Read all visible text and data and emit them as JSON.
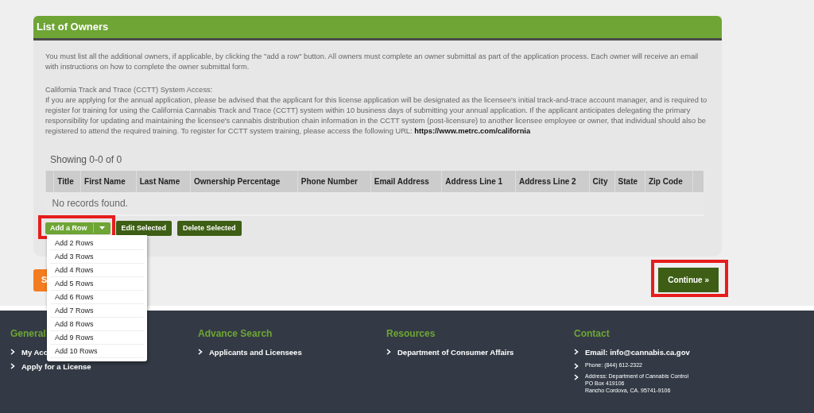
{
  "panel": {
    "title": "List of Owners",
    "intro": "You must list all the additional owners, if applicable, by clicking the \"add a row\" button. All owners must complete an owner submittal as part of the application process. Each owner will receive an email with instructions on how to complete the owner submittal form.",
    "cctt_heading": "California Track and Trace (CCTT) System Access:",
    "cctt_text": "If you are applying for the annual application, please be advised that the applicant for this license application will be designated as the licensee's initial track-and-trace account manager, and is required to register for training for using the California Cannabis Track and Trace (CCTT) system within 10 business days of submitting your annual application. If the applicant anticipates delegating the primary responsibility for updating and maintaining the licensee's cannabis distribution chain information in the CCTT system (post-licensure) to another licensee employee or owner, that individual should also be registered to attend the required training. To register for CCTT system training, please access the following URL:",
    "url": "https://www.metrc.com/california"
  },
  "showing": "Showing 0-0 of 0",
  "table": {
    "columns": [
      "Title",
      "First Name",
      "Last Name",
      "Ownership Percentage",
      "Phone Number",
      "Email Address",
      "Address Line 1",
      "Address Line 2",
      "City",
      "State",
      "Zip Code"
    ],
    "empty_message": "No records found."
  },
  "actions": {
    "add_button": "Add a Row",
    "highlighted": true,
    "menu_expanded": true,
    "menu": [
      "Add 2 Rows",
      "Add 3 Rows",
      "Add 4 Rows",
      "Add 5 Rows",
      "Add 6 Rows",
      "Add 7 Rows",
      "Add 8 Rows",
      "Add 9 Rows",
      "Add 10 Rows"
    ],
    "buttons": [
      "Edit Selected",
      "Delete Selected"
    ]
  },
  "back_button": "S",
  "continue": {
    "label": "Continue »",
    "highlighted": true
  },
  "footer": [
    {
      "heading": "General",
      "links": [
        {
          "text": "My Acc",
          "kind": "link"
        },
        {
          "text": "Apply for a License",
          "kind": "link"
        }
      ]
    },
    {
      "heading": "Advance Search",
      "links": [
        {
          "text": "Applicants and Licensees",
          "kind": "link"
        }
      ]
    },
    {
      "heading": "Resources",
      "links": [
        {
          "text": "Department of Consumer Affairs",
          "kind": "link"
        }
      ]
    },
    {
      "heading": "Contact",
      "links": [
        {
          "text": "Email: info@cannabis.ca.gov",
          "kind": "link"
        },
        {
          "text": "Phone: (844) 612-2322",
          "kind": "detail"
        },
        {
          "text": "Address: Department of Cannabis Control\nPO Box 419106\nRancho Cordova, CA. 95741-9106",
          "kind": "detail"
        }
      ]
    }
  ]
}
